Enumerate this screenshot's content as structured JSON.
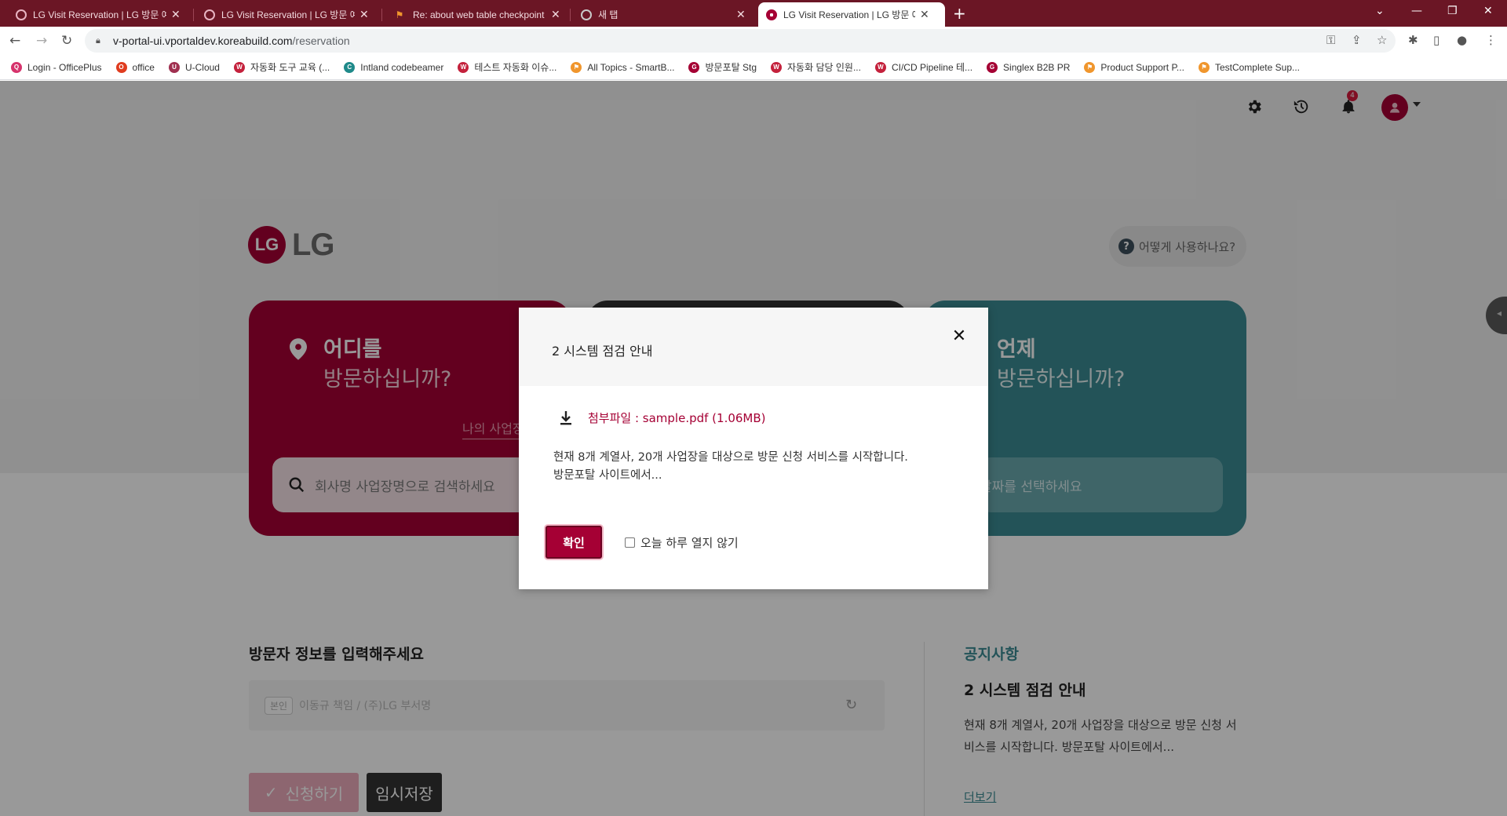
{
  "browser": {
    "tabs": [
      {
        "label": "LG Visit Reservation | LG 방문 예약",
        "active": false
      },
      {
        "label": "LG Visit Reservation | LG 방문 예약",
        "active": false
      },
      {
        "label": "Re: about web table checkpoint",
        "active": false
      },
      {
        "label": "새 탭",
        "active": false
      },
      {
        "label": "LG Visit Reservation | LG 방문 예약",
        "active": true
      }
    ],
    "url_host": "v-portal-ui.vportaldev.koreabuild.com",
    "url_path": "/reservation",
    "bookmarks": [
      {
        "label": "Login - OfficePlus",
        "color": "#d6336c",
        "glyph": "Q"
      },
      {
        "label": "office",
        "color": "#e03c1f",
        "glyph": "O"
      },
      {
        "label": "U-Cloud",
        "color": "#a03050",
        "glyph": "U"
      },
      {
        "label": "자동화 도구 교육 (...",
        "color": "#c4213c",
        "glyph": "W"
      },
      {
        "label": "Intland codebeamer",
        "color": "#1f8a8a",
        "glyph": "C"
      },
      {
        "label": "테스트 자동화 이슈...",
        "color": "#c4213c",
        "glyph": "W"
      },
      {
        "label": "All Topics - SmartB...",
        "color": "#f0962d",
        "glyph": "⚑"
      },
      {
        "label": "방문포탈 Stg",
        "color": "#a50034",
        "glyph": "G"
      },
      {
        "label": "자동화 담당 인원...",
        "color": "#c4213c",
        "glyph": "W"
      },
      {
        "label": "CI/CD Pipeline 테...",
        "color": "#c4213c",
        "glyph": "W"
      },
      {
        "label": "Singlex B2B PR",
        "color": "#a50034",
        "glyph": "G"
      },
      {
        "label": "Product Support P...",
        "color": "#f0962d",
        "glyph": "⚑"
      },
      {
        "label": "TestComplete Sup...",
        "color": "#f0962d",
        "glyph": "⚑"
      }
    ]
  },
  "header": {
    "notification_count": "4"
  },
  "logo": {
    "mark": "LG",
    "text": "LG"
  },
  "help": {
    "label": "어떻게 사용하나요?"
  },
  "cards": {
    "where": {
      "title": "어디를",
      "subtitle": "방문하십니까?",
      "my_site_link": "나의 사업장",
      "search_placeholder": "회사명 사업장명으로 검색하세요"
    },
    "when": {
      "title": "언제",
      "subtitle": "방문하십니까?",
      "date_placeholder": "날짜를 선택하세요"
    }
  },
  "visitor": {
    "title": "방문자 정보를 입력해주세요",
    "tag": "본인",
    "placeholder": "이동규 책임 / (주)LG 부서명",
    "apply_label": "신청하기",
    "save_label": "임시저장"
  },
  "notice": {
    "heading": "공지사항",
    "title": "2 시스템 점검 안내",
    "body": "현재 8개 계열사, 20개 사업장을 대상으로 방문 신청 서비스를 시작합니다. 방문포탈 사이트에서...",
    "more": "더보기"
  },
  "modal": {
    "title": "2 시스템 점검 안내",
    "attachment": "첨부파일 : sample.pdf (1.06MB)",
    "body_line1": "현재 8개 계열사, 20개 사업장을 대상으로 방문 신청 서비스를 시작합니다.",
    "body_line2": "방문포탈 사이트에서...",
    "confirm_label": "확인",
    "dont_show_label": "오늘 하루 열지 않기"
  },
  "colors": {
    "brand": "#a50034",
    "teal": "#3b8b93",
    "dark": "#333333"
  }
}
